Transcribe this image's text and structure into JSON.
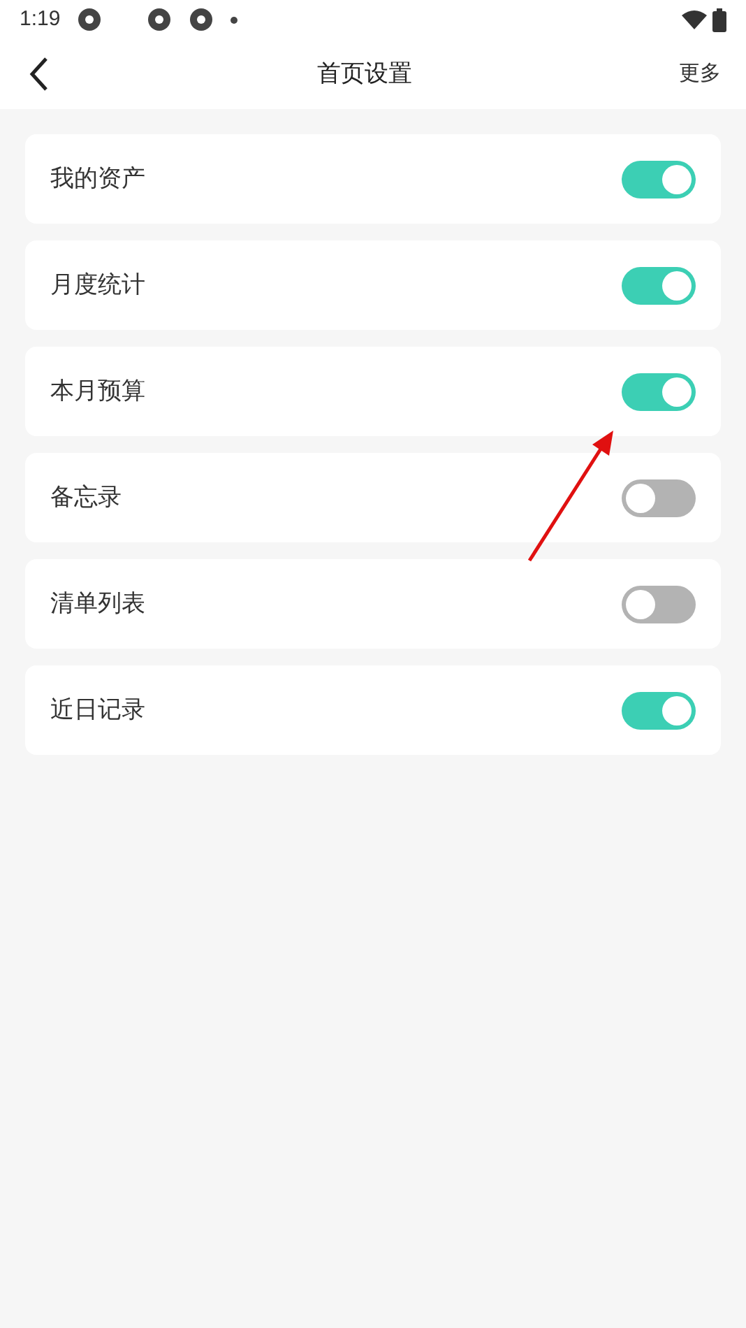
{
  "status_bar": {
    "time": "1:19"
  },
  "header": {
    "title": "首页设置",
    "action": "更多"
  },
  "settings": [
    {
      "label": "我的资产",
      "on": true
    },
    {
      "label": "月度统计",
      "on": true
    },
    {
      "label": "本月预算",
      "on": true
    },
    {
      "label": "备忘录",
      "on": false
    },
    {
      "label": "清单列表",
      "on": false
    },
    {
      "label": "近日记录",
      "on": true
    }
  ]
}
